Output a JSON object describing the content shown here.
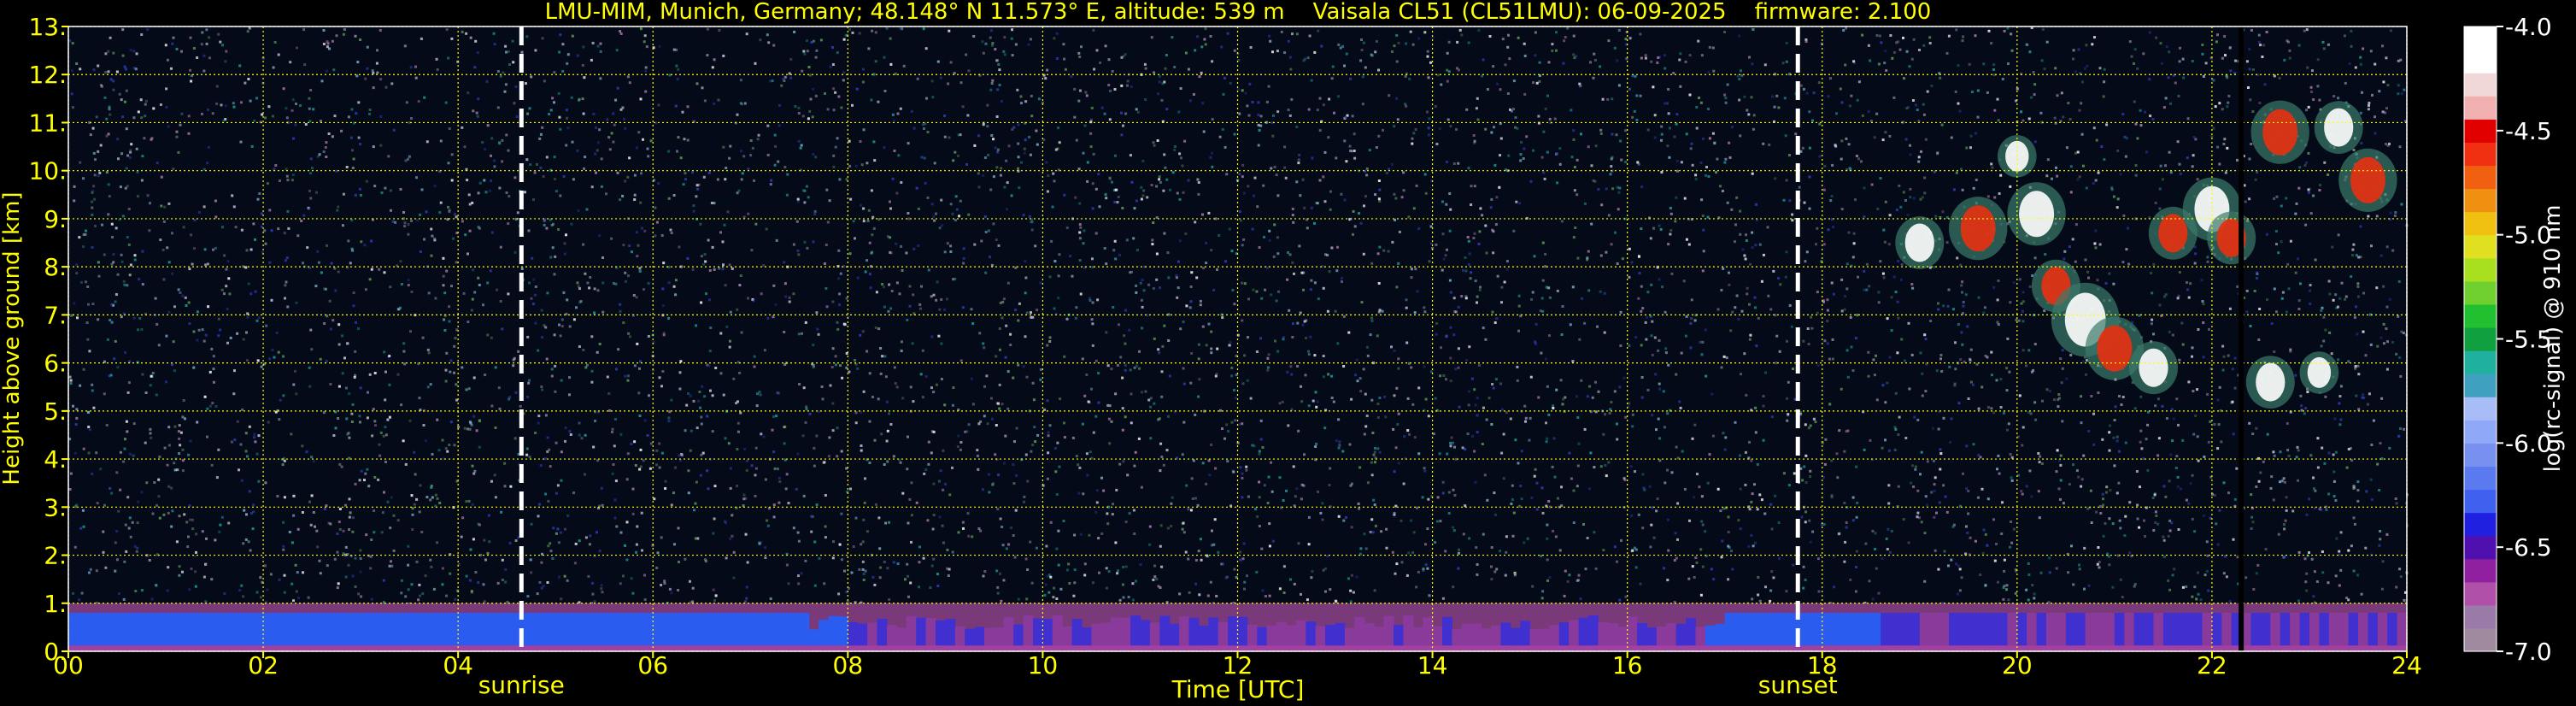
{
  "header": {
    "title": "LMU-MIM, Munich, Germany; 48.148° N 11.573° E, altitude: 539 m    Vaisala CL51 (CL51LMU): 06-09-2025    firmware: 2.100"
  },
  "chart_data": {
    "type": "heatmap",
    "xlabel": "Time [UTC]",
    "ylabel": "Height above ground [km]",
    "x_ticks": [
      "00",
      "02",
      "04",
      "06",
      "08",
      "10",
      "12",
      "14",
      "16",
      "18",
      "20",
      "22",
      "24"
    ],
    "y_ticks": [
      "0.",
      "1.",
      "2.",
      "3.",
      "4.",
      "5.",
      "6.",
      "7.",
      "8.",
      "9.",
      "10.",
      "11.",
      "12.",
      "13."
    ],
    "xlim": [
      0,
      24
    ],
    "ylim": [
      0,
      13
    ],
    "grid": true,
    "events": [
      {
        "label": "sunrise",
        "time": 4.65
      },
      {
        "label": "sunset",
        "time": 17.75
      }
    ],
    "data_gap_time": 22.3,
    "colorbar": {
      "label": "log(rc-signal) @ 910 nm",
      "range": [
        -7.0,
        -4.0
      ],
      "ticks": [
        "-4.0",
        "-4.5",
        "-5.0",
        "-5.5",
        "-6.0",
        "-6.5",
        "-7.0"
      ],
      "colors": [
        "#a08aa0",
        "#9a7aa8",
        "#b050a8",
        "#9020a0",
        "#5010b0",
        "#2020e0",
        "#4060f0",
        "#5b7af0",
        "#7890f0",
        "#90a8f8",
        "#a8bcf8",
        "#40a0c0",
        "#20b0a0",
        "#10a040",
        "#20c030",
        "#70d030",
        "#a8e020",
        "#e0e020",
        "#f0c010",
        "#f09010",
        "#f06010",
        "#f03010",
        "#e00000",
        "#f0b0b0",
        "#f0d8d8",
        "#ffffff",
        "#ffffff"
      ]
    },
    "layers": [
      {
        "name": "boundary layer",
        "time_range": [
          0,
          24
        ],
        "height_km": [
          0,
          1.0
        ]
      },
      {
        "name": "high cloud",
        "time_range": [
          18.5,
          24
        ],
        "height_km": [
          5.5,
          11.5
        ]
      }
    ]
  }
}
